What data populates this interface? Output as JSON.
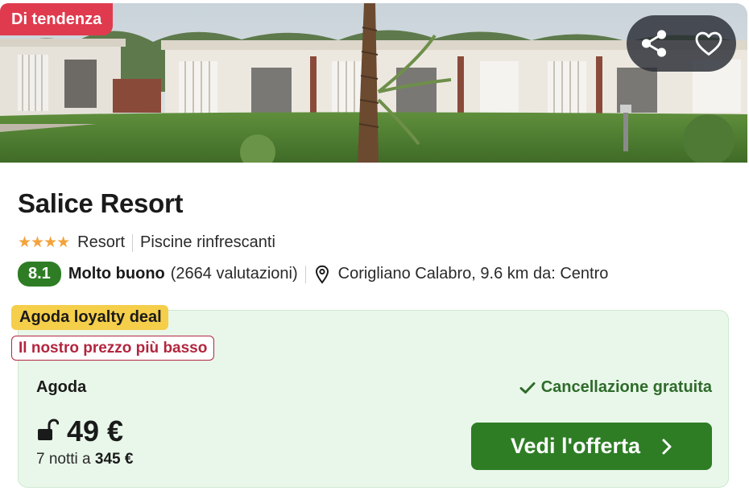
{
  "hero": {
    "badge": "Di tendenza",
    "share_icon": "share-icon",
    "favorite_icon": "heart-icon"
  },
  "hotel": {
    "name": "Salice Resort",
    "stars": "★★★★",
    "star_count": 4,
    "type": "Resort",
    "feature": "Piscine rinfrescanti",
    "score": "8.1",
    "rating_word": "Molto buono",
    "reviews": "(2664 valutazioni)",
    "location": "Corigliano Calabro, 9.6 km da: Centro"
  },
  "offer": {
    "loyalty_label": "Agoda loyalty deal",
    "lowest_price_label": "Il nostro prezzo più basso",
    "provider": "Agoda",
    "cancellation": "Cancellazione gratuita",
    "price": "49 €",
    "nights_prefix": "7 notti a",
    "nights_total": "345 €",
    "cta_label": "Vedi l'offerta"
  },
  "colors": {
    "badge_red": "#e03a4e",
    "score_green": "#2e7d25",
    "offer_bg": "#e9f7ea",
    "loyalty_yellow": "#f5ce4a",
    "lowest_red": "#b3253f",
    "star_orange": "#f3a33c"
  }
}
